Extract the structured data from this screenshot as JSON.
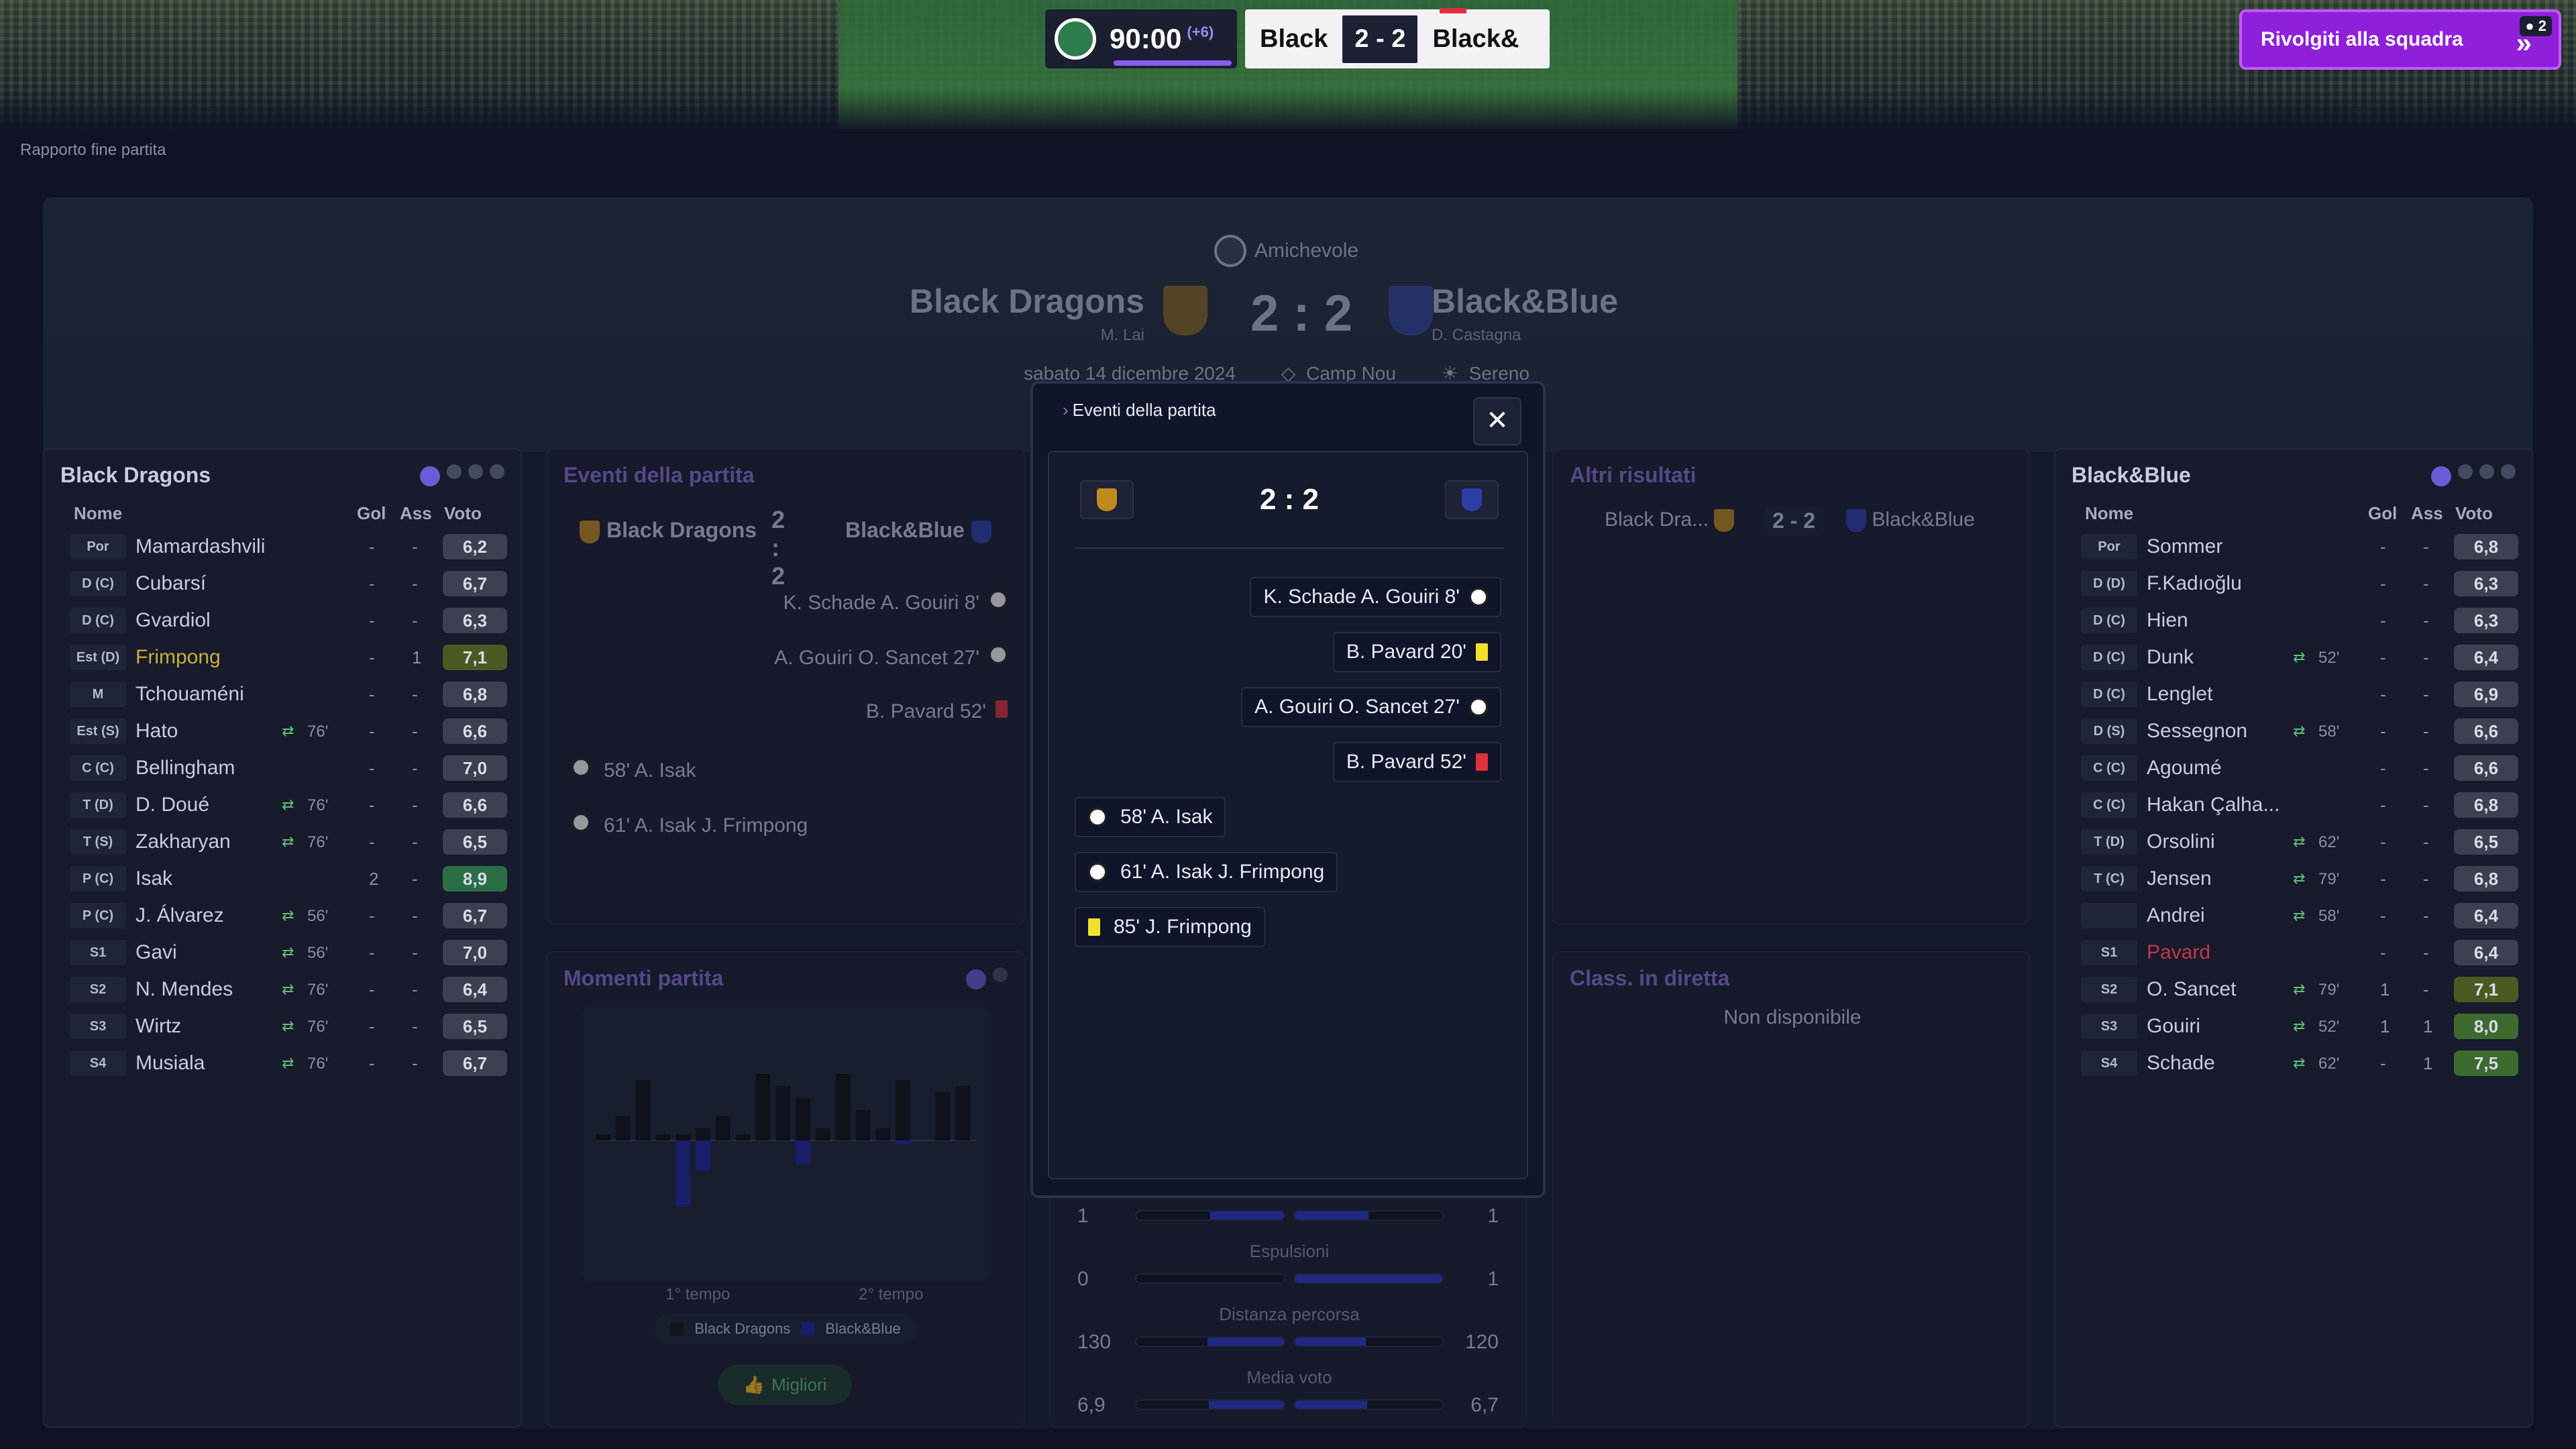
{
  "header": {
    "clock": "90:00",
    "added": "(+6)",
    "home_short": "Black",
    "score": "2 - 2",
    "away_short": "Black&",
    "talk_button": "Rivolgiti alla squadra",
    "notif_count": "2"
  },
  "breadcrumb": "Rapporto fine partita",
  "match": {
    "competition": "Amichevole",
    "home": "Black Dragons",
    "home_manager": "M. Lai",
    "score": "2 : 2",
    "away": "Black&Blue",
    "away_manager": "D. Castagna",
    "date": "sabato 14 dicembre 2024",
    "stadium": "Camp Nou",
    "weather": "Sereno"
  },
  "home_panel": {
    "title": "Black Dragons",
    "cols": [
      "Nome",
      "Gol",
      "Ass",
      "Voto"
    ],
    "players": [
      {
        "pos": "Por",
        "name": "Mamardashvili",
        "sub": "",
        "gol": "-",
        "ass": "-",
        "voto": "6,2"
      },
      {
        "pos": "D (C)",
        "name": "Cubarsí",
        "sub": "",
        "gol": "-",
        "ass": "-",
        "voto": "6,7"
      },
      {
        "pos": "D (C)",
        "name": "Gvardiol",
        "sub": "",
        "gol": "-",
        "ass": "-",
        "voto": "6,3"
      },
      {
        "pos": "Est (D)",
        "name": "Frimpong",
        "sub": "",
        "gol": "-",
        "ass": "1",
        "voto": "7,1"
      },
      {
        "pos": "M",
        "name": "Tchouaméni",
        "sub": "",
        "gol": "-",
        "ass": "-",
        "voto": "6,8"
      },
      {
        "pos": "Est (S)",
        "name": "Hato",
        "sub": "76'",
        "gol": "-",
        "ass": "-",
        "voto": "6,6"
      },
      {
        "pos": "C (C)",
        "name": "Bellingham",
        "sub": "",
        "gol": "-",
        "ass": "-",
        "voto": "7,0"
      },
      {
        "pos": "T (D)",
        "name": "D. Doué",
        "sub": "76'",
        "gol": "-",
        "ass": "-",
        "voto": "6,6"
      },
      {
        "pos": "T (S)",
        "name": "Zakharyan",
        "sub": "76'",
        "gol": "-",
        "ass": "-",
        "voto": "6,5"
      },
      {
        "pos": "P (C)",
        "name": "Isak",
        "sub": "",
        "gol": "2",
        "ass": "-",
        "voto": "8,9"
      },
      {
        "pos": "P (C)",
        "name": "J. Álvarez",
        "sub": "56'",
        "gol": "-",
        "ass": "-",
        "voto": "6,7"
      },
      {
        "pos": "S1",
        "name": "Gavi",
        "sub": "56'",
        "gol": "-",
        "ass": "-",
        "voto": "7,0"
      },
      {
        "pos": "S2",
        "name": "N. Mendes",
        "sub": "76'",
        "gol": "-",
        "ass": "-",
        "voto": "6,4"
      },
      {
        "pos": "S3",
        "name": "Wirtz",
        "sub": "76'",
        "gol": "-",
        "ass": "-",
        "voto": "6,5"
      },
      {
        "pos": "S4",
        "name": "Musiala",
        "sub": "76'",
        "gol": "-",
        "ass": "-",
        "voto": "6,7"
      }
    ]
  },
  "away_panel": {
    "title": "Black&Blue",
    "cols": [
      "Nome",
      "Gol",
      "Ass",
      "Voto"
    ],
    "players": [
      {
        "pos": "Por",
        "name": "Sommer",
        "sub": "",
        "gol": "-",
        "ass": "-",
        "voto": "6,8"
      },
      {
        "pos": "D (D)",
        "name": "F.Kadıoğlu",
        "sub": "",
        "gol": "-",
        "ass": "-",
        "voto": "6,3"
      },
      {
        "pos": "D (C)",
        "name": "Hien",
        "sub": "",
        "gol": "-",
        "ass": "-",
        "voto": "6,3"
      },
      {
        "pos": "D (C)",
        "name": "Dunk",
        "sub": "52'",
        "gol": "-",
        "ass": "-",
        "voto": "6,4"
      },
      {
        "pos": "D (C)",
        "name": "Lenglet",
        "sub": "",
        "gol": "-",
        "ass": "-",
        "voto": "6,9"
      },
      {
        "pos": "D (S)",
        "name": "Sessegnon",
        "sub": "58'",
        "gol": "-",
        "ass": "-",
        "voto": "6,6"
      },
      {
        "pos": "C (C)",
        "name": "Agoumé",
        "sub": "",
        "gol": "-",
        "ass": "-",
        "voto": "6,6"
      },
      {
        "pos": "C (C)",
        "name": "Hakan Çalha...",
        "sub": "",
        "gol": "-",
        "ass": "-",
        "voto": "6,8"
      },
      {
        "pos": "T (D)",
        "name": "Orsolini",
        "sub": "62'",
        "gol": "-",
        "ass": "-",
        "voto": "6,5"
      },
      {
        "pos": "T (C)",
        "name": "Jensen",
        "sub": "79'",
        "gol": "-",
        "ass": "-",
        "voto": "6,8"
      },
      {
        "pos": "",
        "name": "Andrei",
        "sub": "58'",
        "gol": "-",
        "ass": "-",
        "voto": "6,4"
      },
      {
        "pos": "S1",
        "name": "Pavard",
        "sub": "",
        "gol": "-",
        "ass": "-",
        "voto": "6,4"
      },
      {
        "pos": "S2",
        "name": "O. Sancet",
        "sub": "79'",
        "gol": "1",
        "ass": "-",
        "voto": "7,1"
      },
      {
        "pos": "S3",
        "name": "Gouiri",
        "sub": "52'",
        "gol": "1",
        "ass": "1",
        "voto": "8,0"
      },
      {
        "pos": "S4",
        "name": "Schade",
        "sub": "62'",
        "gol": "-",
        "ass": "1",
        "voto": "7,5"
      }
    ]
  },
  "events_panel": {
    "title": "Eventi della partita",
    "home": "Black Dragons",
    "score": "2 :\n2",
    "away": "Black&Blue",
    "right": [
      "K. Schade A. Gouiri 8'",
      "A. Gouiri O. Sancet 27'",
      "B. Pavard 52'"
    ],
    "left": [
      "58' A. Isak",
      "61' A. Isak J. Frimpong"
    ]
  },
  "moments_panel": {
    "title": "Momenti partita",
    "label1": "1° tempo",
    "label2": "2° tempo",
    "legend_home": "Black Dragons",
    "legend_away": "Black&Blue",
    "button": "Migliori"
  },
  "other_results": {
    "title": "Altri risultati",
    "home": "Black Dra...",
    "score": "2 - 2",
    "away": "Black&Blue"
  },
  "live_table": {
    "title": "Class. in diretta",
    "empty": "Non disponibile"
  },
  "stats": [
    {
      "label": "",
      "home": "1",
      "away": "1",
      "home_pct": 0.5,
      "away_pct": 0.5
    },
    {
      "label": "Espulsioni",
      "home": "0",
      "away": "1",
      "home_pct": 0.0,
      "away_pct": 1.0
    },
    {
      "label": "Distanza percorsa",
      "home": "130",
      "away": "120",
      "home_pct": 0.52,
      "away_pct": 0.48
    },
    {
      "label": "Media voto",
      "home": "6,9",
      "away": "6,7",
      "home_pct": 0.51,
      "away_pct": 0.49
    }
  ],
  "modal": {
    "title": "Eventi della partita",
    "score": "2 : 2",
    "events": [
      {
        "side": "away",
        "text": "K. Schade A. Gouiri 8'",
        "icon": "goal"
      },
      {
        "side": "away",
        "text": "B. Pavard 20'",
        "icon": "yellow"
      },
      {
        "side": "away",
        "text": "A. Gouiri O. Sancet 27'",
        "icon": "goal"
      },
      {
        "side": "away",
        "text": "B. Pavard 52'",
        "icon": "red"
      },
      {
        "side": "home",
        "text": "58' A. Isak",
        "icon": "goal"
      },
      {
        "side": "home",
        "text": "61' A. Isak J. Frimpong",
        "icon": "goal"
      },
      {
        "side": "home",
        "text": "85' J. Frimpong",
        "icon": "yellow"
      }
    ]
  },
  "moments_chart": {
    "home": [
      0.05,
      0.2,
      0.5,
      0.05,
      0.05,
      0.1,
      0.2,
      0.05,
      0.55,
      0.45,
      0.35,
      0.1,
      0.55,
      0.25,
      0.1,
      0.5,
      0,
      0.4,
      0.45
    ],
    "away": [
      0,
      0,
      0,
      0,
      -0.55,
      -0.25,
      0,
      0,
      0,
      0,
      -0.2,
      0,
      0,
      0,
      0,
      -0.03,
      0,
      0,
      0
    ]
  }
}
